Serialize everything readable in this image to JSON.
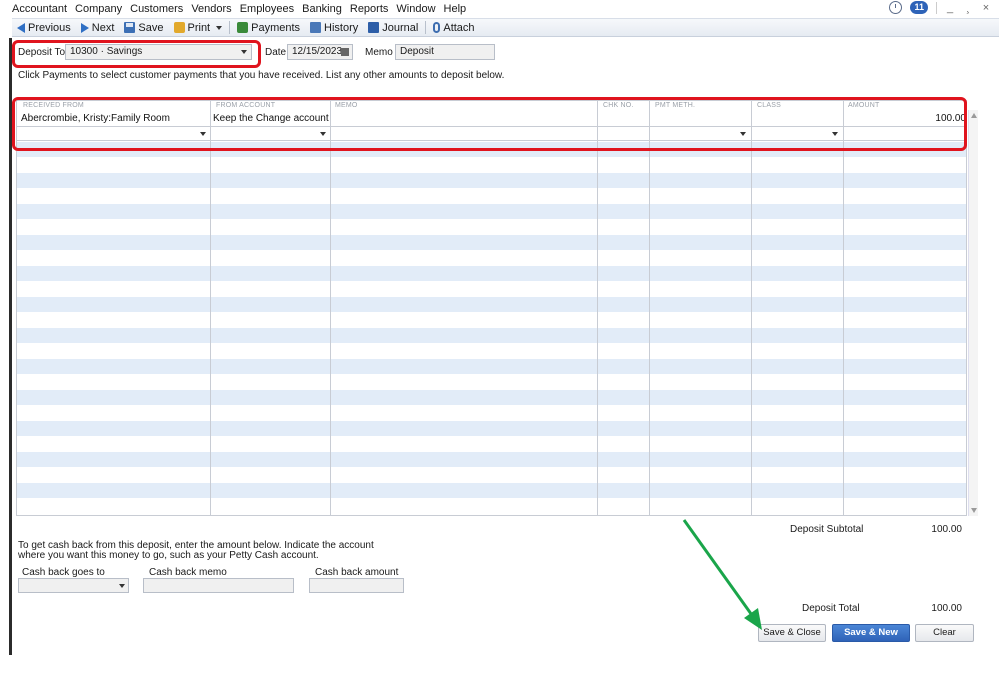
{
  "menu": [
    "Accountant",
    "Company",
    "Customers",
    "Vendors",
    "Employees",
    "Banking",
    "Reports",
    "Window",
    "Help"
  ],
  "window_controls": {
    "badge": "11",
    "minimize": "_",
    "restore": "¸",
    "close": "×"
  },
  "toolbar": {
    "previous": "Previous",
    "next": "Next",
    "save": "Save",
    "print": "Print",
    "payments": "Payments",
    "history": "History",
    "journal": "Journal",
    "attach": "Attach"
  },
  "header": {
    "deposit_to_label": "Deposit To",
    "deposit_to_value": "10300 · Savings",
    "date_label": "Date",
    "date_value": "12/15/2023",
    "memo_label": "Memo",
    "memo_value": "Deposit"
  },
  "instructions": "Click Payments to select customer payments that you have received. List any other amounts to deposit below.",
  "grid": {
    "columns": [
      "RECEIVED FROM",
      "FROM ACCOUNT",
      "MEMO",
      "CHK NO.",
      "PMT METH.",
      "CLASS",
      "AMOUNT"
    ],
    "rows": [
      {
        "received_from": "Abercrombie, Kristy:Family Room",
        "from_account": "Keep the Change account",
        "memo": "",
        "chk_no": "",
        "pmt_meth": "",
        "class": "",
        "amount": "100.00"
      }
    ]
  },
  "cash_back": {
    "instructions_line1": "To get cash back from this deposit, enter the amount below.  Indicate the account",
    "instructions_line2": "where you want this money to go, such as your Petty Cash account.",
    "goes_to_label": "Cash back goes to",
    "memo_label": "Cash back memo",
    "amount_label": "Cash back amount"
  },
  "totals": {
    "subtotal_label": "Deposit Subtotal",
    "subtotal_value": "100.00",
    "total_label": "Deposit Total",
    "total_value": "100.00"
  },
  "buttons": {
    "save_close": "Save & Close",
    "save_new": "Save & New",
    "clear": "Clear"
  },
  "colors": {
    "highlight_box": "#e0141e",
    "annotation_arrow": "#1aa54a",
    "stripe": "#e2ecf8",
    "primary_button": "#2f63b8"
  }
}
